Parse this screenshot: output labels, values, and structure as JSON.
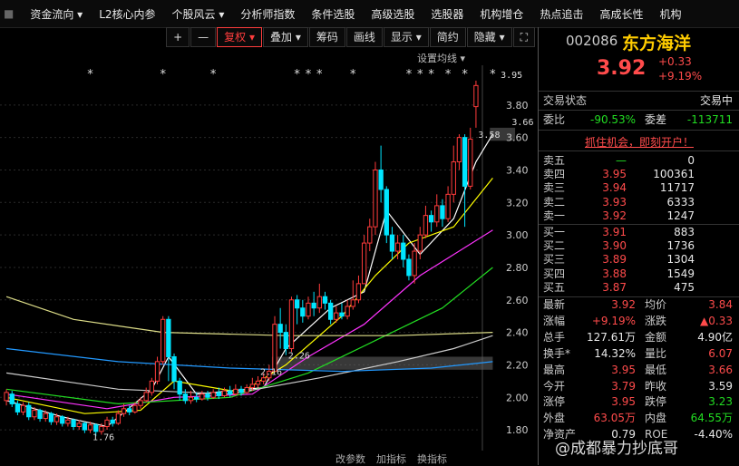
{
  "topmenu": [
    "资金流向 ▾",
    "L2核心内参",
    "个股风云 ▾",
    "分析师指数",
    "条件选股",
    "高级选股",
    "选股器",
    "机构增仓",
    "热点追击",
    "高成长性",
    "机构"
  ],
  "toolbar": {
    "plus": "+",
    "minus": "—",
    "adj": "复权 ▾",
    "overlay": "叠加 ▾",
    "chips": "筹码",
    "draw": "画线",
    "display": "显示 ▾",
    "simple": "简约",
    "hide": "隐藏 ▾"
  },
  "setma": "设置均线 ▾",
  "bottomtabs": [
    "改参数",
    "加指标",
    "换指标"
  ],
  "stock": {
    "code": "002086",
    "name": "东方海洋",
    "price": "3.92",
    "chg": "+0.33",
    "pct": "+9.19%"
  },
  "status": {
    "label": "交易状态",
    "value": "交易中"
  },
  "weibi": {
    "label": "委比",
    "value": "-90.53%",
    "label2": "委差",
    "value2": "-113711"
  },
  "ad": "抓住机会，即刻开户！",
  "orderbook": {
    "sells": [
      {
        "label": "卖五",
        "price": "—",
        "vol": "0"
      },
      {
        "label": "卖四",
        "price": "3.95",
        "vol": "100361"
      },
      {
        "label": "卖三",
        "price": "3.94",
        "vol": "11717"
      },
      {
        "label": "卖二",
        "price": "3.93",
        "vol": "6333"
      },
      {
        "label": "卖一",
        "price": "3.92",
        "vol": "1247"
      }
    ],
    "buys": [
      {
        "label": "买一",
        "price": "3.91",
        "vol": "883"
      },
      {
        "label": "买二",
        "price": "3.90",
        "vol": "1736"
      },
      {
        "label": "买三",
        "price": "3.89",
        "vol": "1304"
      },
      {
        "label": "买四",
        "price": "3.88",
        "vol": "1549"
      },
      {
        "label": "买五",
        "price": "3.87",
        "vol": "475"
      }
    ]
  },
  "stats": [
    {
      "l1": "最新",
      "v1": "3.92",
      "c1": "red",
      "l2": "均价",
      "v2": "3.84",
      "c2": "red"
    },
    {
      "l1": "涨幅",
      "v1": "+9.19%",
      "c1": "red",
      "l2": "涨跌",
      "v2": "▲0.33",
      "c2": "red"
    },
    {
      "l1": "总手",
      "v1": "127.61万",
      "c1": "white",
      "l2": "金额",
      "v2": "4.90亿",
      "c2": "white"
    },
    {
      "l1": "换手*",
      "v1": "14.32%",
      "c1": "white",
      "l2": "量比",
      "v2": "6.07",
      "c2": "red"
    },
    {
      "l1": "最高",
      "v1": "3.95",
      "c1": "red",
      "l2": "最低",
      "v2": "3.66",
      "c2": "red"
    },
    {
      "l1": "今开",
      "v1": "3.79",
      "c1": "red",
      "l2": "昨收",
      "v2": "3.59",
      "c2": "white"
    },
    {
      "l1": "涨停",
      "v1": "3.95",
      "c1": "red",
      "l2": "跌停",
      "v2": "3.23",
      "c2": "green"
    },
    {
      "l1": "外盘",
      "v1": "63.05万",
      "c1": "red",
      "l2": "内盘",
      "v2": "64.55万",
      "c2": "green"
    },
    {
      "l1": "净资产",
      "v1": "0.79",
      "c1": "white",
      "l2": "ROE",
      "v2": "-4.40%",
      "c2": "white"
    }
  ],
  "watermark": "@成都暴力抄底哥",
  "chart_data": {
    "type": "candlestick",
    "yticks": [
      "3.80",
      "3.60",
      "3.40",
      "3.20",
      "3.00",
      "2.80",
      "2.60",
      "2.40",
      "2.20",
      "2.00",
      "1.80"
    ],
    "ylim": [
      1.7,
      4.0
    ],
    "annotations": [
      {
        "text": "3.95",
        "x": 91,
        "y": 3.95
      },
      {
        "text": "3.58",
        "x": 87,
        "y": 3.58
      },
      {
        "text": "3.66",
        "x": 93,
        "y": 3.66
      },
      {
        "text": "2.16",
        "x": 48,
        "y": 2.16
      },
      {
        "text": "2.26",
        "x": 53,
        "y": 2.26
      },
      {
        "text": "1.76",
        "x": 18,
        "y": 1.76
      }
    ],
    "stars": [
      15,
      28,
      37,
      52,
      54,
      56,
      62,
      72,
      74,
      76,
      79,
      82,
      87
    ],
    "candles": [
      [
        1.98,
        2.03,
        2.05,
        1.95
      ],
      [
        2.02,
        1.96,
        2.04,
        1.94
      ],
      [
        1.96,
        1.91,
        1.98,
        1.89
      ],
      [
        1.91,
        1.95,
        1.97,
        1.89
      ],
      [
        1.95,
        1.88,
        1.97,
        1.86
      ],
      [
        1.88,
        1.92,
        1.94,
        1.86
      ],
      [
        1.92,
        1.87,
        1.93,
        1.85
      ],
      [
        1.87,
        1.9,
        1.92,
        1.85
      ],
      [
        1.9,
        1.85,
        1.91,
        1.83
      ],
      [
        1.85,
        1.88,
        1.9,
        1.83
      ],
      [
        1.88,
        1.84,
        1.89,
        1.82
      ],
      [
        1.84,
        1.86,
        1.88,
        1.82
      ],
      [
        1.86,
        1.82,
        1.87,
        1.8
      ],
      [
        1.82,
        1.84,
        1.86,
        1.8
      ],
      [
        1.84,
        1.8,
        1.85,
        1.78
      ],
      [
        1.8,
        1.83,
        1.85,
        1.78
      ],
      [
        1.83,
        1.79,
        1.84,
        1.76
      ],
      [
        1.79,
        1.82,
        1.84,
        1.77
      ],
      [
        1.82,
        1.86,
        1.88,
        1.8
      ],
      [
        1.86,
        1.84,
        1.88,
        1.82
      ],
      [
        1.84,
        1.9,
        1.92,
        1.83
      ],
      [
        1.9,
        1.93,
        1.96,
        1.88
      ],
      [
        1.93,
        1.91,
        1.95,
        1.89
      ],
      [
        1.91,
        1.95,
        1.97,
        1.9
      ],
      [
        1.95,
        1.98,
        2.0,
        1.93
      ],
      [
        1.98,
        2.03,
        2.06,
        1.97
      ],
      [
        2.03,
        2.1,
        2.12,
        2.01
      ],
      [
        2.1,
        2.22,
        2.25,
        2.08
      ],
      [
        2.22,
        2.48,
        2.5,
        2.2
      ],
      [
        2.48,
        2.25,
        2.5,
        2.1
      ],
      [
        2.25,
        2.1,
        2.27,
        2.05
      ],
      [
        2.1,
        2.02,
        2.12,
        1.98
      ],
      [
        2.02,
        1.98,
        2.05,
        1.96
      ],
      [
        1.98,
        2.0,
        2.04,
        1.96
      ],
      [
        2.0,
        1.99,
        2.03,
        1.97
      ],
      [
        1.99,
        2.02,
        2.04,
        1.98
      ],
      [
        2.02,
        2.0,
        2.04,
        1.98
      ],
      [
        2.0,
        2.03,
        2.05,
        1.99
      ],
      [
        2.03,
        2.01,
        2.06,
        1.99
      ],
      [
        2.01,
        2.04,
        2.06,
        2.0
      ],
      [
        2.04,
        2.02,
        2.07,
        2.0
      ],
      [
        2.02,
        2.05,
        2.08,
        2.01
      ],
      [
        2.05,
        2.03,
        2.07,
        2.01
      ],
      [
        2.03,
        2.06,
        2.08,
        2.02
      ],
      [
        2.06,
        2.08,
        2.12,
        2.04
      ],
      [
        2.08,
        2.1,
        2.13,
        2.06
      ],
      [
        2.1,
        2.12,
        2.15,
        2.08
      ],
      [
        2.12,
        2.16,
        2.2,
        2.1
      ],
      [
        2.16,
        2.45,
        2.5,
        2.16
      ],
      [
        2.45,
        2.4,
        2.55,
        2.3
      ],
      [
        2.4,
        2.3,
        2.45,
        2.26
      ],
      [
        2.3,
        2.6,
        2.62,
        2.28
      ],
      [
        2.6,
        2.55,
        2.63,
        2.45
      ],
      [
        2.55,
        2.5,
        2.6,
        2.46
      ],
      [
        2.5,
        2.58,
        2.62,
        2.48
      ],
      [
        2.58,
        2.55,
        2.65,
        2.5
      ],
      [
        2.55,
        2.62,
        2.7,
        2.52
      ],
      [
        2.62,
        2.58,
        2.65,
        2.54
      ],
      [
        2.58,
        2.48,
        2.6,
        2.45
      ],
      [
        2.48,
        2.52,
        2.56,
        2.46
      ],
      [
        2.52,
        2.5,
        2.58,
        2.48
      ],
      [
        2.5,
        2.56,
        2.6,
        2.48
      ],
      [
        2.56,
        2.6,
        2.72,
        2.54
      ],
      [
        2.6,
        2.7,
        2.75,
        2.58
      ],
      [
        2.7,
        2.95,
        3.0,
        2.7
      ],
      [
        2.95,
        3.05,
        3.1,
        2.9
      ],
      [
        3.05,
        3.4,
        3.45,
        3.0
      ],
      [
        3.4,
        3.28,
        3.55,
        3.2
      ],
      [
        3.28,
        3.0,
        3.3,
        2.95
      ],
      [
        3.0,
        2.9,
        3.05,
        2.85
      ],
      [
        2.9,
        2.95,
        3.0,
        2.85
      ],
      [
        2.95,
        2.85,
        3.0,
        2.8
      ],
      [
        2.85,
        2.75,
        2.88,
        2.72
      ],
      [
        2.75,
        2.9,
        2.95,
        2.7
      ],
      [
        2.9,
        3.0,
        3.05,
        2.85
      ],
      [
        3.0,
        3.12,
        3.18,
        2.98
      ],
      [
        3.12,
        3.08,
        3.15,
        3.02
      ],
      [
        3.08,
        3.18,
        3.25,
        3.05
      ],
      [
        3.18,
        3.1,
        3.22,
        3.05
      ],
      [
        3.1,
        3.25,
        3.3,
        3.08
      ],
      [
        3.25,
        3.45,
        3.55,
        3.2
      ],
      [
        3.45,
        3.6,
        3.62,
        3.4
      ],
      [
        3.6,
        3.3,
        3.62,
        3.05
      ],
      [
        3.3,
        3.59,
        3.66,
        3.28
      ],
      [
        3.79,
        3.92,
        3.95,
        3.66
      ]
    ],
    "ma_lines": [
      {
        "name": "MA5",
        "color": "#ffffff",
        "points": [
          [
            0,
            1.98
          ],
          [
            10,
            1.88
          ],
          [
            18,
            1.82
          ],
          [
            26,
            2.05
          ],
          [
            29,
            2.25
          ],
          [
            34,
            2.02
          ],
          [
            46,
            2.06
          ],
          [
            50,
            2.3
          ],
          [
            58,
            2.55
          ],
          [
            64,
            2.65
          ],
          [
            68,
            3.15
          ],
          [
            74,
            2.88
          ],
          [
            80,
            3.1
          ],
          [
            84,
            3.45
          ],
          [
            87,
            3.62
          ]
        ]
      },
      {
        "name": "MA10",
        "color": "#ffff00",
        "points": [
          [
            0,
            2.0
          ],
          [
            14,
            1.9
          ],
          [
            24,
            1.92
          ],
          [
            30,
            2.1
          ],
          [
            42,
            2.03
          ],
          [
            50,
            2.2
          ],
          [
            60,
            2.5
          ],
          [
            66,
            2.75
          ],
          [
            72,
            2.95
          ],
          [
            80,
            3.05
          ],
          [
            87,
            3.35
          ]
        ]
      },
      {
        "name": "MA20",
        "color": "#ff33ff",
        "points": [
          [
            0,
            2.02
          ],
          [
            18,
            1.93
          ],
          [
            30,
            2.0
          ],
          [
            44,
            2.02
          ],
          [
            54,
            2.25
          ],
          [
            64,
            2.45
          ],
          [
            74,
            2.75
          ],
          [
            87,
            3.03
          ]
        ]
      },
      {
        "name": "MA30",
        "color": "#22dd22",
        "points": [
          [
            0,
            2.05
          ],
          [
            20,
            1.96
          ],
          [
            40,
            2.0
          ],
          [
            54,
            2.15
          ],
          [
            66,
            2.35
          ],
          [
            78,
            2.55
          ],
          [
            87,
            2.8
          ]
        ]
      },
      {
        "name": "MA60",
        "color": "#cccccc",
        "points": [
          [
            0,
            2.15
          ],
          [
            20,
            2.05
          ],
          [
            40,
            2.02
          ],
          [
            56,
            2.12
          ],
          [
            70,
            2.22
          ],
          [
            80,
            2.3
          ],
          [
            87,
            2.38
          ]
        ]
      },
      {
        "name": "MA120",
        "color": "#2299ff",
        "points": [
          [
            0,
            2.3
          ],
          [
            20,
            2.22
          ],
          [
            40,
            2.18
          ],
          [
            60,
            2.16
          ],
          [
            76,
            2.18
          ],
          [
            87,
            2.22
          ]
        ]
      },
      {
        "name": "MA250",
        "color": "#dddd88",
        "points": [
          [
            0,
            2.62
          ],
          [
            12,
            2.48
          ],
          [
            28,
            2.4
          ],
          [
            50,
            2.38
          ],
          [
            70,
            2.38
          ],
          [
            87,
            2.4
          ]
        ]
      }
    ],
    "highlight_boxes": [
      {
        "x0": 48,
        "x1": 87,
        "y0": 2.17,
        "y1": 2.25
      },
      {
        "x0": 87,
        "x1": 91,
        "y0": 3.58,
        "y1": 3.66
      }
    ]
  }
}
